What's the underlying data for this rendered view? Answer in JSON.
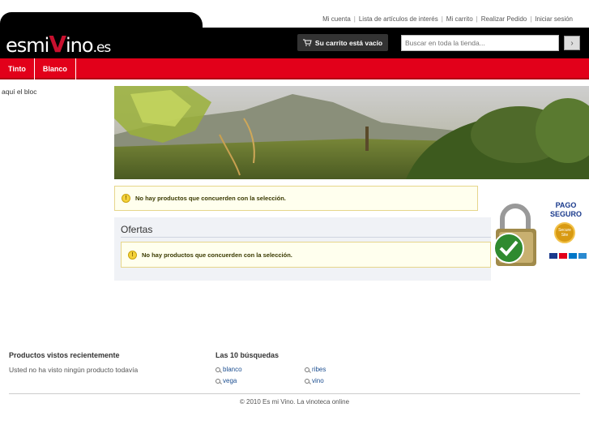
{
  "logo": {
    "part1": "esmi",
    "part2": "V",
    "part3": "ino",
    "part4": ".es"
  },
  "toplinks": [
    "Mi cuenta",
    "Lista de artículos de interés",
    "Mi carrito",
    "Realizar Pedido",
    "Iniciar sesión"
  ],
  "cart": {
    "label": "Su carrito está vacío"
  },
  "search": {
    "placeholder": "Buscar en toda la tienda..."
  },
  "nav": [
    "Tinto",
    "Blanco"
  ],
  "sidebar": {
    "block_text": "aquí el bloc"
  },
  "main": {
    "notice": "No hay productos que concuerden con la selección.",
    "ofertas_title": "Ofertas",
    "ofertas_notice": "No hay productos que concuerden con la selección."
  },
  "badge": {
    "line1": "PAGO",
    "line2": "SEGURO",
    "seal": "Secure Site"
  },
  "footer": {
    "recent_title": "Productos vistos recientemente",
    "recent_text": "Usted no ha visto ningún producto todavía",
    "searches_title": "Las 10 búsquedas",
    "terms": [
      "blanco",
      "ribes",
      "vega",
      "vino"
    ],
    "copyright": "© 2010 Es mi Vino. La vinoteca online"
  },
  "colors": {
    "brand_red": "#e2001a",
    "header_black": "#000000"
  }
}
